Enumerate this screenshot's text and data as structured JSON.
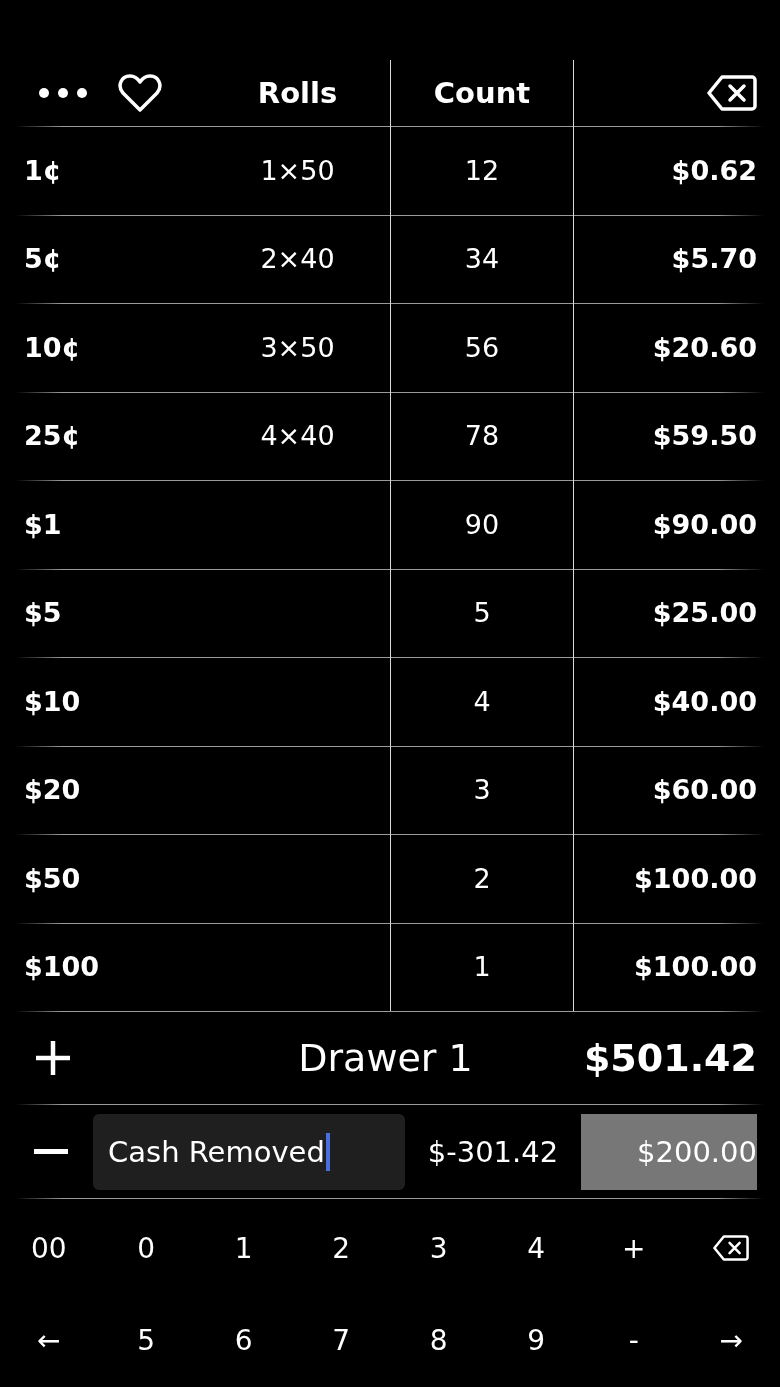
{
  "table": {
    "columns": [
      "Rolls",
      "Count"
    ],
    "rows": [
      {
        "denomination": "1¢",
        "rolls": "1×50",
        "count": "12",
        "amount": "$0.62"
      },
      {
        "denomination": "5¢",
        "rolls": "2×40",
        "count": "34",
        "amount": "$5.70"
      },
      {
        "denomination": "10¢",
        "rolls": "3×50",
        "count": "56",
        "amount": "$20.60"
      },
      {
        "denomination": "25¢",
        "rolls": "4×40",
        "count": "78",
        "amount": "$59.50"
      },
      {
        "denomination": "$1",
        "count": "90",
        "amount": "$90.00"
      },
      {
        "denomination": "$5",
        "count": "5",
        "amount": "$25.00"
      },
      {
        "denomination": "$10",
        "count": "4",
        "amount": "$40.00"
      },
      {
        "denomination": "$20",
        "count": "3",
        "amount": "$60.00"
      },
      {
        "denomination": "$50",
        "count": "2",
        "amount": "$100.00"
      },
      {
        "denomination": "$100",
        "count": "1",
        "amount": "$100.00"
      }
    ]
  },
  "drawer": {
    "name": "Drawer 1",
    "total": "$501.42"
  },
  "adjustment": {
    "note": "Cash Removed",
    "focused": true,
    "difference": "$-301.42",
    "amount": "$200.00",
    "highlighted": true
  },
  "keypad": [
    [
      {
        "kind": "text",
        "label": "00"
      },
      {
        "kind": "text",
        "label": "0"
      },
      {
        "kind": "text",
        "label": "1"
      },
      {
        "kind": "text",
        "label": "2"
      },
      {
        "kind": "text",
        "label": "3"
      },
      {
        "kind": "text",
        "label": "4"
      },
      {
        "kind": "text",
        "label": "+"
      },
      {
        "kind": "backspace"
      }
    ],
    [
      {
        "kind": "text",
        "label": "←"
      },
      {
        "kind": "text",
        "label": "5"
      },
      {
        "kind": "text",
        "label": "6"
      },
      {
        "kind": "text",
        "label": "7"
      },
      {
        "kind": "text",
        "label": "8"
      },
      {
        "kind": "text",
        "label": "9"
      },
      {
        "kind": "text",
        "label": "-"
      },
      {
        "kind": "text",
        "label": "→"
      }
    ]
  ]
}
